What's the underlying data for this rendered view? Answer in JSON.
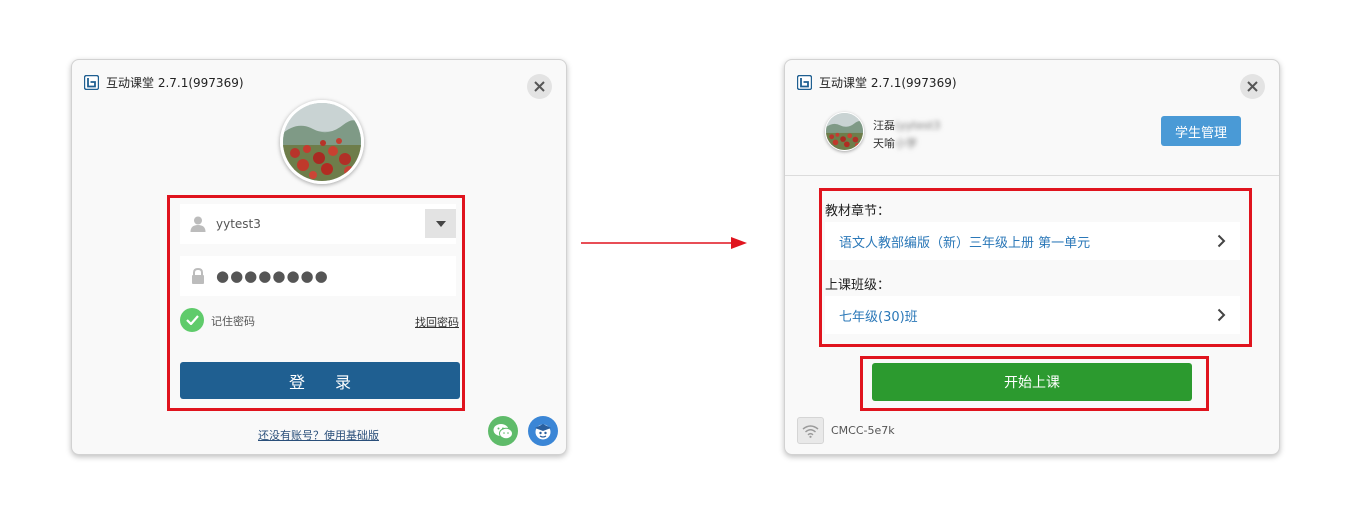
{
  "login_window": {
    "title": "互动课堂 2.7.1(997369)",
    "username": "yytest3",
    "password_mask": "●●●●●●●●",
    "remember_label": "记住密码",
    "forgot_label": "找回密码",
    "login_label": "登录",
    "basic_link": "还没有账号？使用基础版"
  },
  "main_window": {
    "title": "互动课堂 2.7.1(997369)",
    "user_name_visible": "汪磊",
    "user_name_blurred": "(yytest3",
    "user_school_visible": "天喻",
    "user_school_blurred": "小学",
    "student_btn": "学生管理",
    "textbook_label": "教材章节：",
    "textbook_value": "语文人教部编版（新）三年级上册 第一单元",
    "class_label": "上课班级：",
    "class_value": "七年级(30)班",
    "start_btn": "开始上课",
    "wifi_name": "CMCC-5e7k"
  },
  "colors": {
    "primary_blue": "#1f5f91",
    "accent_blue": "#4a9ad6",
    "link_blue": "#2b78b8",
    "start_green": "#2c9a2f",
    "check_green": "#5fcb6b",
    "highlight_red": "#e0141e"
  },
  "icons": [
    "app-logo-icon",
    "close-icon",
    "user-icon",
    "lock-icon",
    "dropdown-icon",
    "check-icon",
    "wechat-icon",
    "assistant-icon",
    "chevron-right-icon",
    "wifi-icon",
    "arrow-right-icon"
  ]
}
